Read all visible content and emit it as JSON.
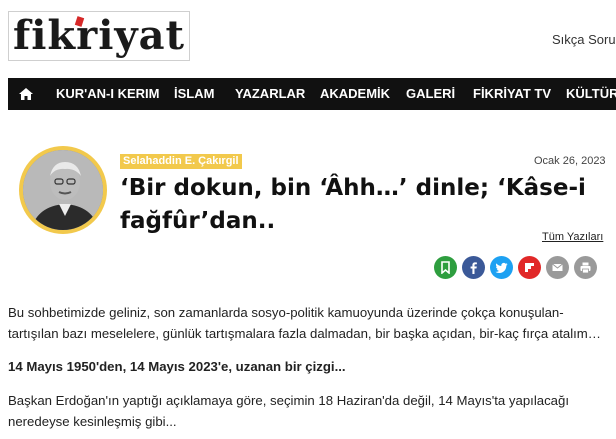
{
  "header": {
    "logo_text": "fikriyat",
    "faq_link": "Sıkça Sorula"
  },
  "nav": {
    "items": [
      {
        "label": "KUR'AN-I KERIM"
      },
      {
        "label": "İSLAM"
      },
      {
        "label": "YAZARLAR"
      },
      {
        "label": "AKADEMİK"
      },
      {
        "label": "GALERİ"
      },
      {
        "label": "FİKRİYAT TV"
      },
      {
        "label": "KÜLTÜR"
      }
    ]
  },
  "article": {
    "author": "Selahaddin E. Çakırgil",
    "date": "Ocak 26, 2023",
    "title": "‘Bir dokun, bin ‘Âhh…’ dinle; ‘Kâse-i fağfûr’dan..",
    "all_posts_label": "Tüm Yazıları",
    "paragraphs": [
      "Bu sohbetimizde geliniz, son zamanlarda sosyo-politik kamuoyunda üzerinde çokça konuşulan-tartışılan bazı meselelere, günlük tartışmalara fazla dalmadan, bir başka açıdan, bir-kaç fırça atalım…",
      "14 Mayıs 1950'den, 14 Mayıs 2023'e, uzanan bir çizgi...",
      "Başkan Erdoğan'ın yaptığı açıklamaya göre, seçimin 18 Haziran'da değil, 14 Mayıs'ta yapılacağı neredeyse kesinleşmiş gibi..."
    ]
  },
  "share": [
    {
      "icon": "bookmark-icon",
      "color": "#2e9e3f"
    },
    {
      "icon": "facebook-icon",
      "color": "#3b5998"
    },
    {
      "icon": "twitter-icon",
      "color": "#1da1f2"
    },
    {
      "icon": "flipboard-icon",
      "color": "#e12828"
    },
    {
      "icon": "email-icon",
      "color": "#9a9a9a"
    },
    {
      "icon": "print-icon",
      "color": "#9a9a9a"
    }
  ],
  "colors": {
    "nav_bg": "#111111",
    "accent_yellow": "#f2c94c",
    "logo_red": "#d62828"
  }
}
